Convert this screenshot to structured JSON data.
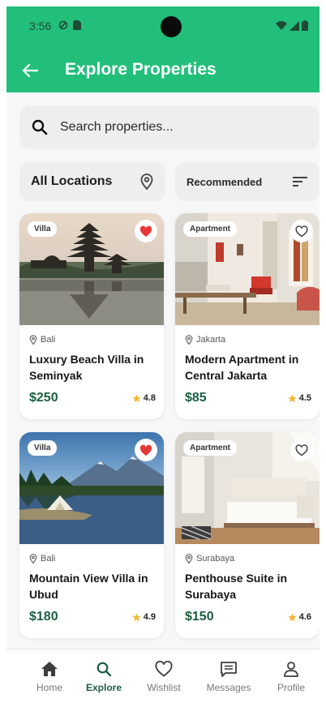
{
  "status": {
    "time": "3:56"
  },
  "appbar": {
    "title": "Explore Properties"
  },
  "search": {
    "placeholder": "Search properties..."
  },
  "filters": {
    "location_label": "All Locations",
    "sort_label": "Recommended"
  },
  "properties": [
    {
      "type": "Villa",
      "location": "Bali",
      "title": "Luxury Beach Villa in Seminyak",
      "price": "$250",
      "rating": "4.8",
      "favorited": true
    },
    {
      "type": "Apartment",
      "location": "Jakarta",
      "title": "Modern Apartment in Central Jakarta",
      "price": "$85",
      "rating": "4.5",
      "favorited": false
    },
    {
      "type": "Villa",
      "location": "Bali",
      "title": "Mountain View Villa in Ubud",
      "price": "$180",
      "rating": "4.9",
      "favorited": true
    },
    {
      "type": "Apartment",
      "location": "Surabaya",
      "title": "Penthouse Suite in Surabaya",
      "price": "$150",
      "rating": "4.6",
      "favorited": false
    }
  ],
  "nav": [
    {
      "label": "Home",
      "icon": "home-icon"
    },
    {
      "label": "Explore",
      "icon": "search-icon",
      "active": true
    },
    {
      "label": "Wishlist",
      "icon": "heart-outline-icon"
    },
    {
      "label": "Messages",
      "icon": "message-icon"
    },
    {
      "label": "Profile",
      "icon": "person-icon"
    }
  ],
  "colors": {
    "primary": "#22bf7b",
    "price": "#1b5e3f",
    "heart": "#e53935",
    "star": "#f5b82e"
  }
}
